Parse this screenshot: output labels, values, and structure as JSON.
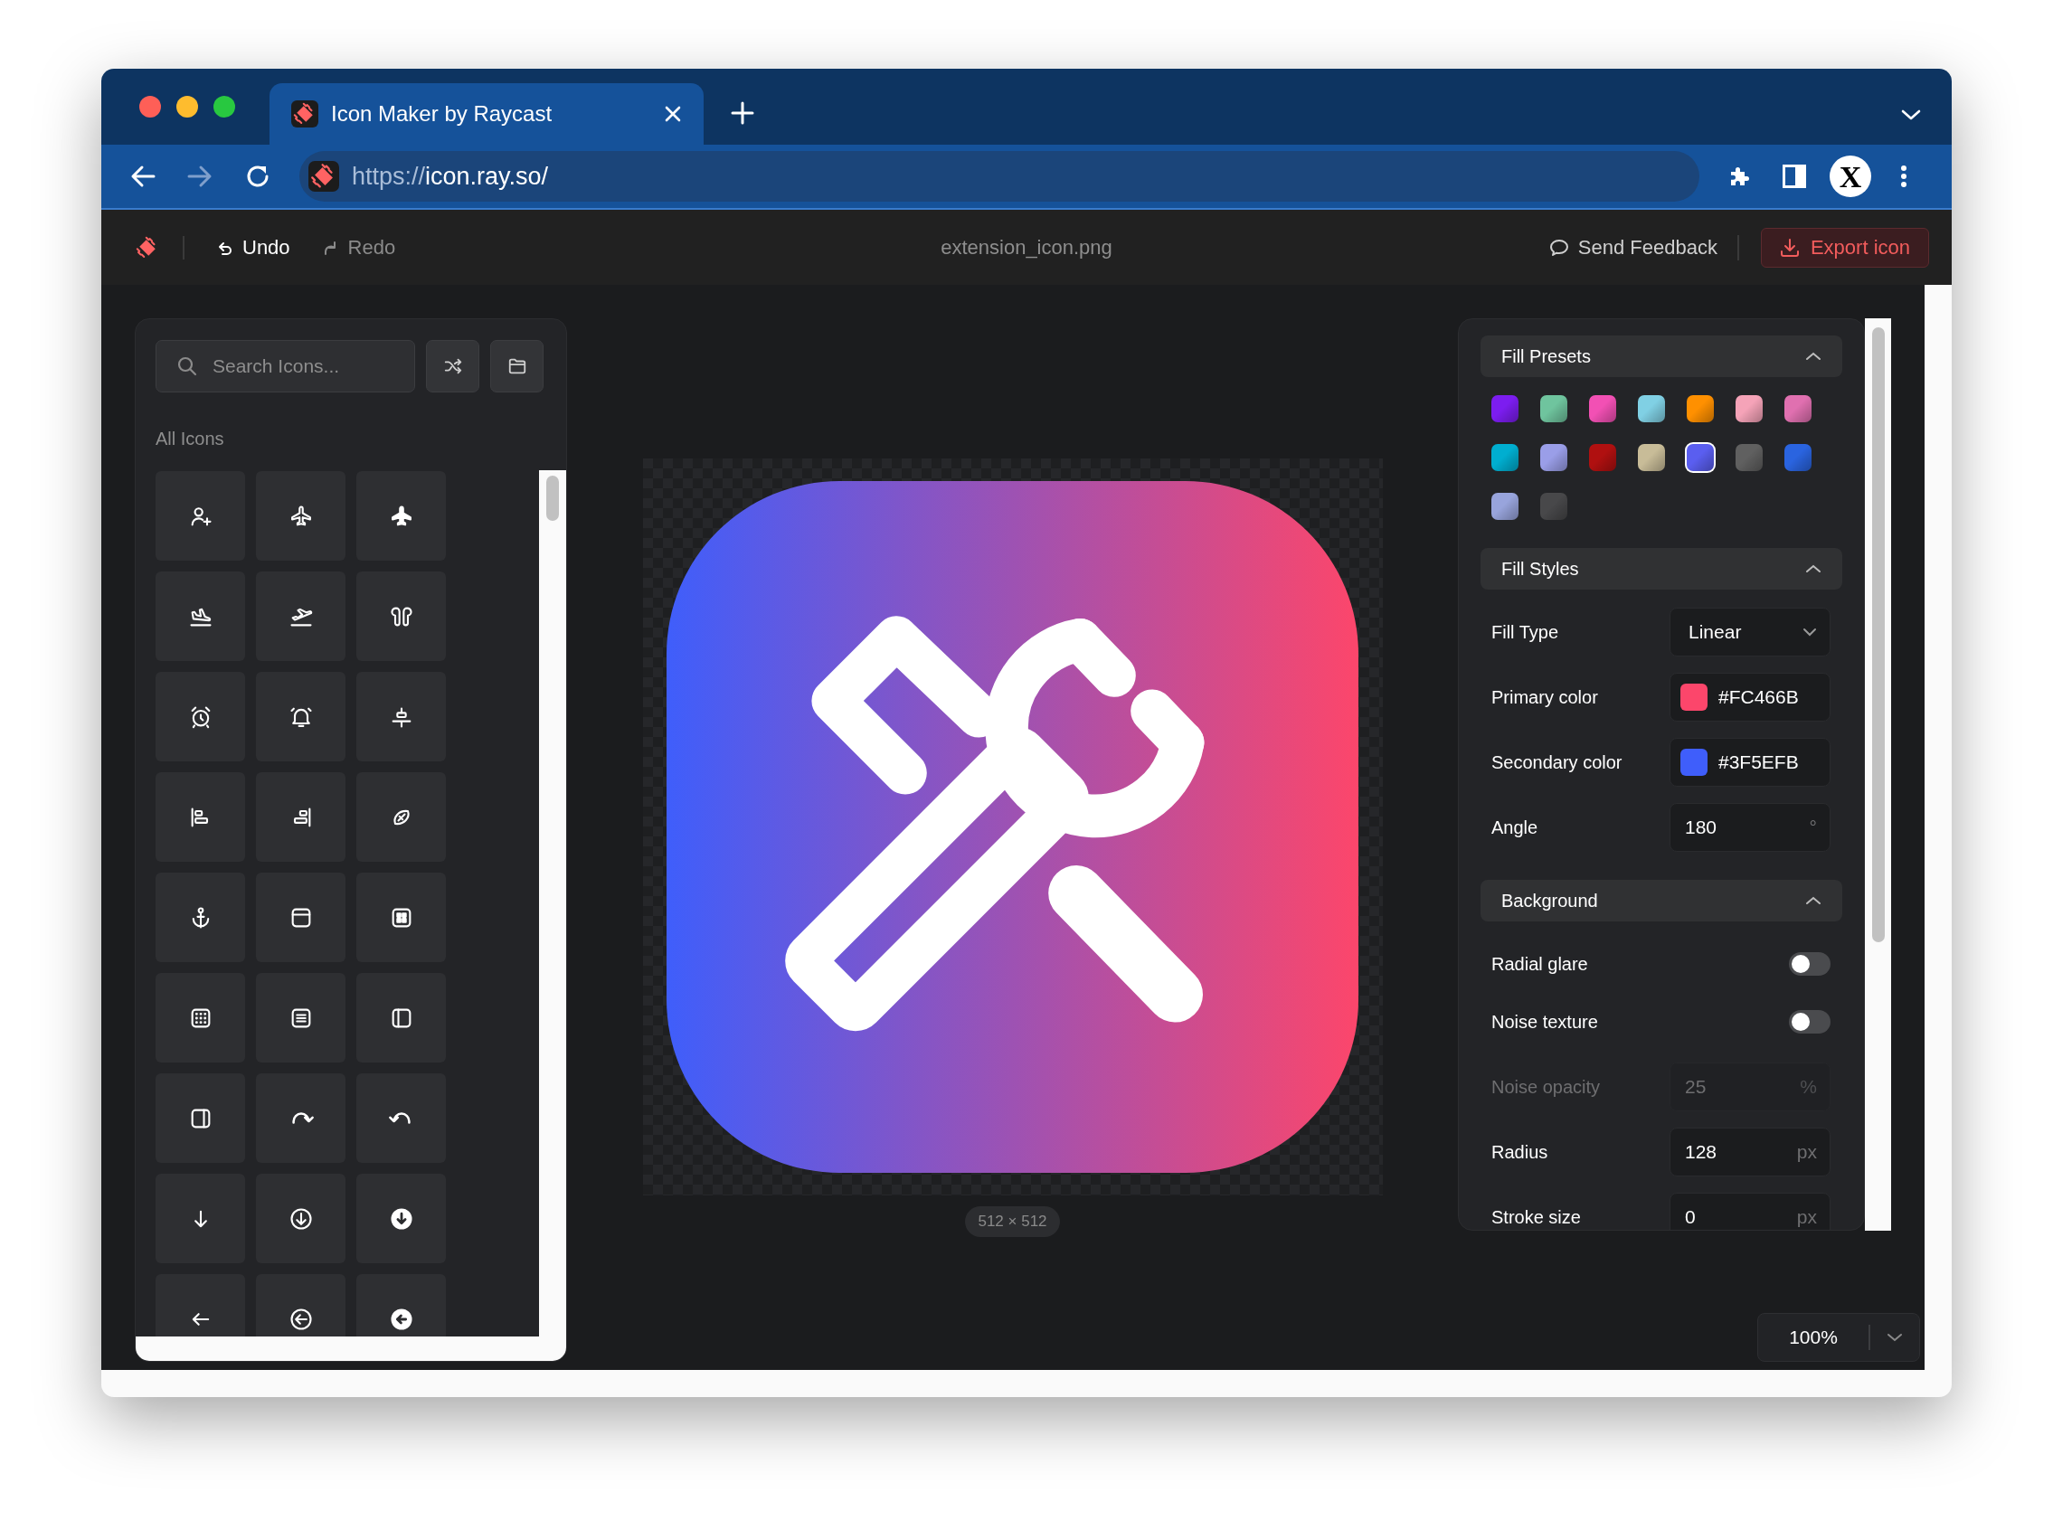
{
  "browser": {
    "tab_title": "Icon Maker by Raycast",
    "url_scheme": "https://",
    "url_rest": "icon.ray.so/",
    "profile_initial": "X"
  },
  "header": {
    "undo": {
      "label": "Undo",
      "disabled": false
    },
    "redo": {
      "label": "Redo",
      "disabled": true
    },
    "filename": "extension_icon.png",
    "feedback": "Send Feedback",
    "export": "Export icon"
  },
  "icon_library": {
    "search_placeholder": "Search Icons...",
    "section_label": "All Icons"
  },
  "preview": {
    "size_label": "512 × 512"
  },
  "sections": [
    {
      "title": "Fill Presets",
      "expanded": true,
      "presets": [
        {
          "color": "#7c1df0",
          "selected": false
        },
        {
          "color": "#6fc49e",
          "selected": false
        },
        {
          "color": "#f250b4",
          "selected": false
        },
        {
          "color": "#80d0e4",
          "selected": false
        },
        {
          "color": "#ff9000",
          "selected": false
        },
        {
          "color": "#f5a3b8",
          "selected": false
        },
        {
          "color": "#e070b0",
          "selected": false
        },
        {
          "color": "#00aed0",
          "selected": false
        },
        {
          "color": "#9a9ee8",
          "selected": false
        },
        {
          "color": "#b01010",
          "selected": false
        },
        {
          "color": "#c8bc98",
          "selected": false
        },
        {
          "color": "#5a5ef0",
          "selected": true
        },
        {
          "color": "#606060",
          "selected": false
        },
        {
          "color": "#2a64e0",
          "selected": false
        },
        {
          "color": "#98a4dc",
          "selected": false
        },
        {
          "color": "#48484a",
          "selected": false
        }
      ]
    },
    {
      "title": "Fill Styles",
      "expanded": true,
      "rows": [
        {
          "kind": "select",
          "label": "Fill Type",
          "value": "Linear"
        },
        {
          "kind": "color",
          "label": "Primary color",
          "value": "#FC466B",
          "color": "#fc466b"
        },
        {
          "kind": "color",
          "label": "Secondary color",
          "value": "#3F5EFB",
          "color": "#3f5efb"
        },
        {
          "kind": "number",
          "label": "Angle",
          "value": "180",
          "unit": "°",
          "disabled": false
        }
      ]
    },
    {
      "title": "Background",
      "expanded": true,
      "rows": [
        {
          "kind": "toggle",
          "label": "Radial glare",
          "on": false
        },
        {
          "kind": "toggle",
          "label": "Noise texture",
          "on": false
        },
        {
          "kind": "number",
          "label": "Noise opacity",
          "value": "25",
          "unit": "%",
          "disabled": true
        },
        {
          "kind": "number",
          "label": "Radius",
          "value": "128",
          "unit": "px",
          "disabled": false
        },
        {
          "kind": "number",
          "label": "Stroke size",
          "value": "0",
          "unit": "px",
          "disabled": false
        }
      ]
    }
  ],
  "zoom": {
    "value": "100%"
  }
}
